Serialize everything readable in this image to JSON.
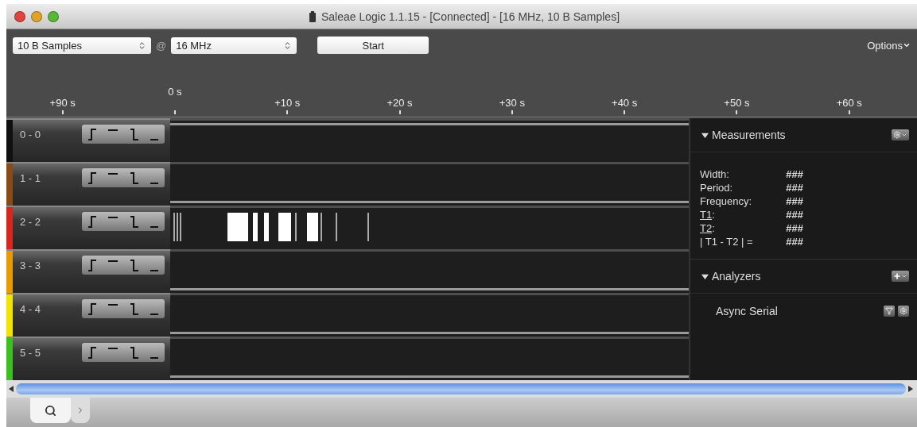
{
  "window": {
    "title": "Saleae Logic 1.1.15 - [Connected] - [16 MHz, 10 B Samples]"
  },
  "toolbar": {
    "samples": "10 B Samples",
    "at": "@",
    "rate": "16 MHz",
    "start_button": "Start",
    "options_button": "Options"
  },
  "ruler": {
    "ticks": [
      {
        "label": "+90 s",
        "kind": "major"
      },
      {
        "label": "0 s",
        "kind": "origin"
      },
      {
        "label": "+10 s",
        "kind": "major"
      },
      {
        "label": "+20 s",
        "kind": "major"
      },
      {
        "label": "+30 s",
        "kind": "major"
      },
      {
        "label": "+40 s",
        "kind": "major"
      },
      {
        "label": "+50 s",
        "kind": "major"
      },
      {
        "label": "+60 s",
        "kind": "major"
      }
    ]
  },
  "channels": [
    {
      "name": "0 - 0",
      "color": "#101010",
      "kind": "flat",
      "high": true
    },
    {
      "name": "1 - 1",
      "color": "#8a4a14",
      "kind": "flat",
      "high": false
    },
    {
      "name": "2 - 2",
      "color": "#d8261c",
      "kind": "pulses",
      "high": false
    },
    {
      "name": "3 - 3",
      "color": "#e89a00",
      "kind": "flat",
      "high": false
    },
    {
      "name": "4 - 4",
      "color": "#f2e400",
      "kind": "flat",
      "high": false
    },
    {
      "name": "5 - 5",
      "color": "#3cc020",
      "kind": "flat",
      "high": false
    }
  ],
  "measurements": {
    "title": "Measurements",
    "expanded": true,
    "rows": [
      {
        "label": "Width:",
        "value": "###",
        "underlined": false
      },
      {
        "label": "Period:",
        "value": "###",
        "underlined": false
      },
      {
        "label": "Frequency:",
        "value": "###",
        "underlined": false
      },
      {
        "label": "T1",
        "suffix": ":",
        "value": "###",
        "underlined": true
      },
      {
        "label": "T2",
        "suffix": ":",
        "value": "###",
        "underlined": true
      },
      {
        "label": "| T1 - T2 | =",
        "value": "###",
        "underlined": false
      }
    ]
  },
  "analyzers": {
    "title": "Analyzers",
    "expanded": true,
    "items": [
      "Async Serial"
    ]
  },
  "bottom_tabs": [
    {
      "kind": "search",
      "selected": true
    },
    {
      "kind": "more",
      "selected": false
    }
  ]
}
